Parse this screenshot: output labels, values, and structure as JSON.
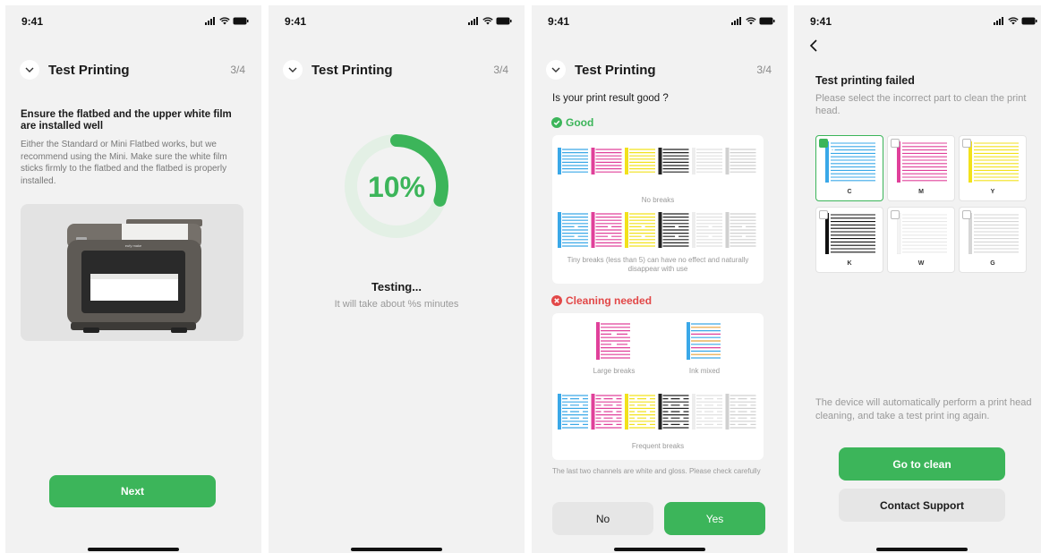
{
  "status_time": "9:41",
  "colors": {
    "accent": "#3cb55a",
    "danger": "#e24848",
    "ring_track": "#e3f0e5"
  },
  "screen1": {
    "title": "Test Printing",
    "step": "3/4",
    "heading": "Ensure the flatbed and the upper white film are installed well",
    "body": "Either the Standard or Mini Flatbed works, but we recommend using the Mini. Make sure the white film sticks firmly to the flatbed and the flatbed is properly installed.",
    "printer_brand": "eufy make",
    "next_button": "Next"
  },
  "screen2": {
    "title": "Test Printing",
    "step": "3/4",
    "progress_label": "10%",
    "progress": 0.3,
    "testing": "Testing...",
    "subtitle": "It will take about %s minutes"
  },
  "screen3": {
    "title": "Test Printing",
    "step": "3/4",
    "question": "Is your print result good ?",
    "good_label": "Good",
    "good_caption_1": "No breaks",
    "good_caption_2": "Tiny breaks (less than 5) can have no effect and naturally disappear with use",
    "bad_label": "Cleaning needed",
    "bad_caption_large": "Large breaks",
    "bad_caption_mixed": "Ink mixed",
    "bad_caption_frequent": "Frequent breaks",
    "note": "The last two channels are white and gloss. Please check carefully",
    "no_button": "No",
    "yes_button": "Yes"
  },
  "screen4": {
    "title": "Test printing failed",
    "subtitle": "Please select the incorrect part to clean the print head.",
    "tiles": [
      {
        "label": "C",
        "color": "#3aa8e8",
        "selected": true
      },
      {
        "label": "M",
        "color": "#e0409a",
        "selected": false
      },
      {
        "label": "Y",
        "color": "#f2e21c",
        "selected": false
      },
      {
        "label": "K",
        "color": "#111111",
        "selected": false
      },
      {
        "label": "W",
        "color": "#f4f4f4",
        "selected": false
      },
      {
        "label": "G",
        "color": "#d6d6d6",
        "selected": false
      }
    ],
    "info": "The device will automatically perform a print head cleaning, and take a test print ing again.",
    "clean_button": "Go to clean",
    "support_button": "Contact Support"
  }
}
